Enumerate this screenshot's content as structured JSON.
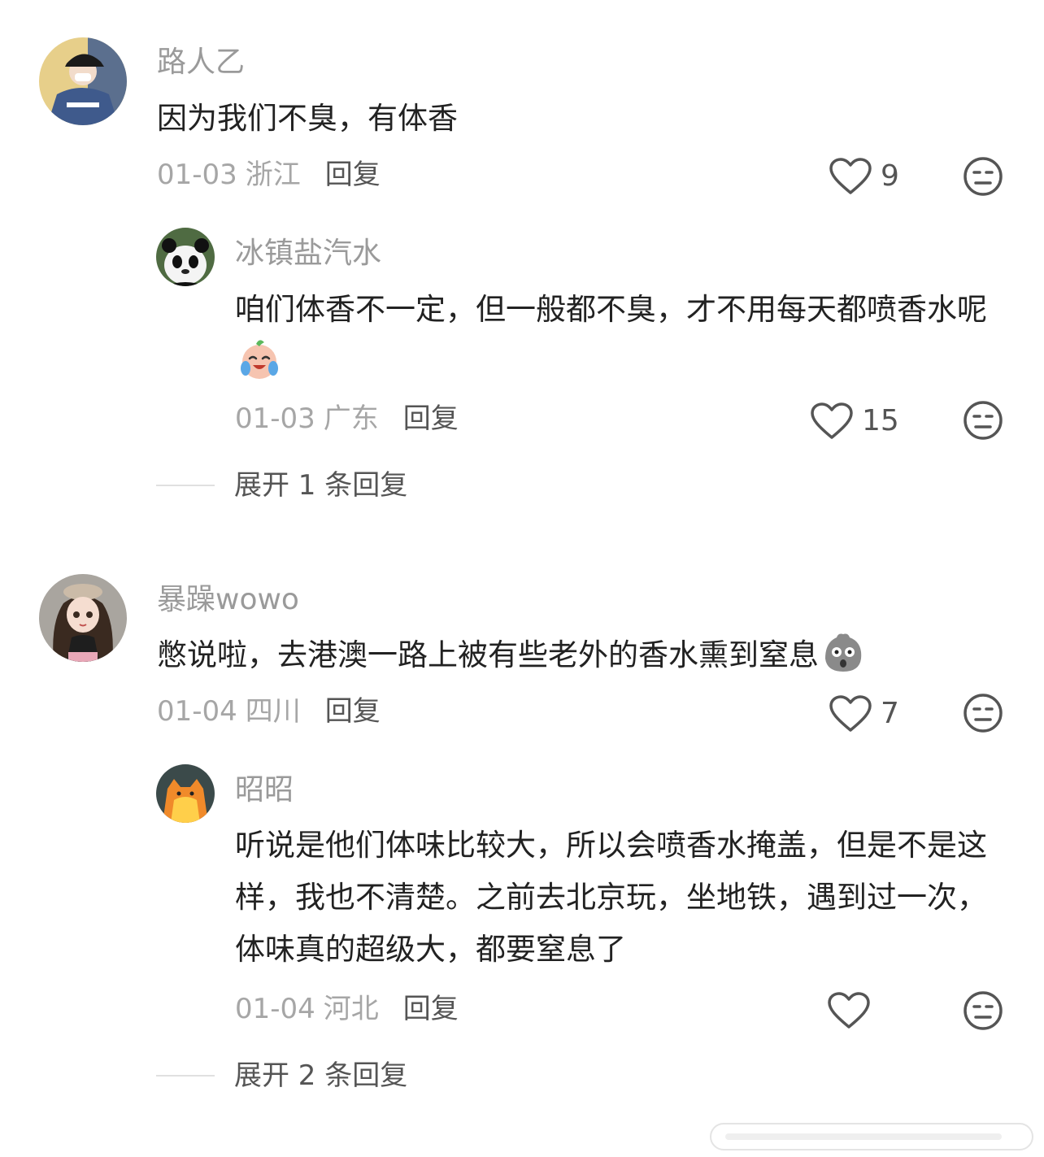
{
  "comments": [
    {
      "username": "路人乙",
      "text": "因为我们不臭，有体香",
      "date": "01-03",
      "region": "浙江",
      "reply_label": "回复",
      "likes": "9",
      "avatar_icon": "person-in-cap-avatar",
      "replies": [
        {
          "username": "冰镇盐汽水",
          "text": "咱们体香不一定，但一般都不臭，才不用每天都喷香水呢",
          "emoji": "crying-laughing-emoji",
          "date": "01-03",
          "region": "广东",
          "reply_label": "回复",
          "likes": "15",
          "avatar_icon": "panda-avatar"
        }
      ],
      "expand_label": "展开 1 条回复"
    },
    {
      "username": "暴躁wowo",
      "text": "憋说啦，去港澳一路上被有些老外的香水熏到窒息",
      "emoji": "shocked-gray-emoji",
      "date": "01-04",
      "region": "四川",
      "reply_label": "回复",
      "likes": "7",
      "avatar_icon": "doll-girl-avatar",
      "replies": [
        {
          "username": "昭昭",
          "text": "听说是他们体味比较大，所以会喷香水掩盖，但是不是这样，我也不清楚。之前去北京玩，坐地铁，遇到过一次，体味真的超级大，都要窒息了",
          "date": "01-04",
          "region": "河北",
          "reply_label": "回复",
          "likes": "",
          "avatar_icon": "orange-cat-avatar"
        }
      ],
      "expand_label": "展开 2 条回复"
    }
  ],
  "colors": {
    "username": "#9a9a9a",
    "body_text": "#222222",
    "meta_gray": "#a6a6a6",
    "action_gray": "#555555"
  }
}
